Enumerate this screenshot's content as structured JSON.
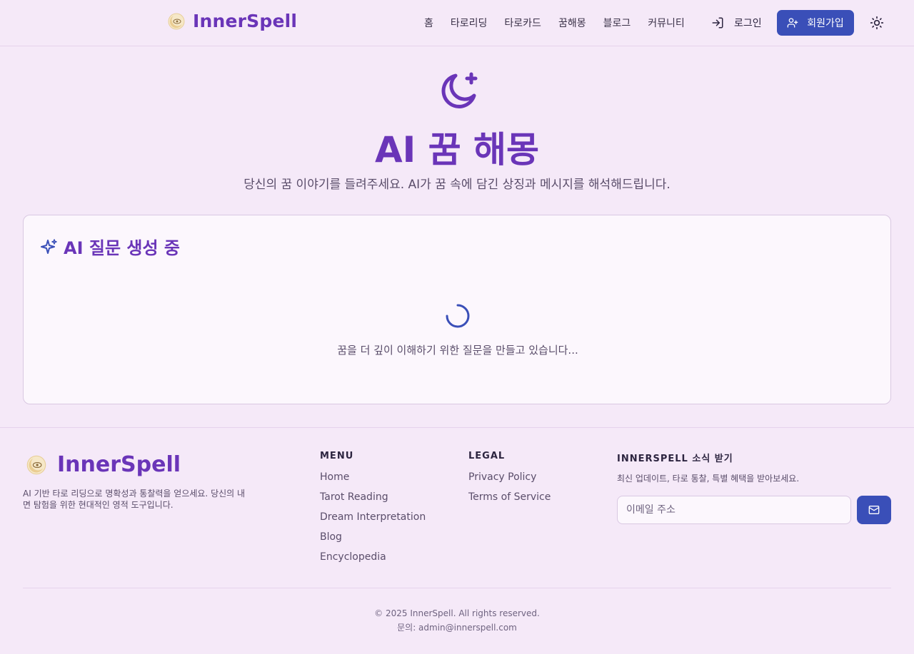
{
  "header": {
    "brand": "InnerSpell",
    "nav": [
      "홈",
      "타로리딩",
      "타로카드",
      "꿈해몽",
      "블로그",
      "커뮤니티"
    ],
    "login_label": "로그인",
    "signup_label": "회원가입"
  },
  "hero": {
    "title": "AI 꿈 해몽",
    "subtitle": "당신의 꿈 이야기를 들려주세요. AI가 꿈 속에 담긴 상징과 메시지를 해석해드립니다."
  },
  "card": {
    "title": "AI 질문 생성 중",
    "message": "꿈을 더 깊이 이해하기 위한 질문을 만들고 있습니다..."
  },
  "footer": {
    "brand": "InnerSpell",
    "description": "AI 기반 타로 리딩으로 명확성과 통찰력을 얻으세요. 당신의 내면 탐험을 위한 현대적인 영적 도구입니다.",
    "menu_heading": "MENU",
    "menu_items": [
      "Home",
      "Tarot Reading",
      "Dream Interpretation",
      "Blog",
      "Encyclopedia"
    ],
    "legal_heading": "LEGAL",
    "legal_items": [
      "Privacy Policy",
      "Terms of Service"
    ],
    "newsletter_heading": "INNERSPELL 소식 받기",
    "newsletter_text": "최신 업데이트, 타로 통찰, 특별 혜택을 받아보세요.",
    "email_placeholder": "이메일 주소",
    "copyright": "© 2025 InnerSpell. All rights reserved.",
    "contact": "문의: admin@innerspell.com"
  },
  "colors": {
    "accent_purple": "#6a35b8",
    "primary_button": "#3a4fb8",
    "background": "#f5e9f8"
  },
  "icons": [
    "brand-logo-icon",
    "login-icon",
    "user-plus-icon",
    "sun-icon",
    "moon-star-icon",
    "sparkles-icon",
    "spinner-icon",
    "mail-icon"
  ]
}
